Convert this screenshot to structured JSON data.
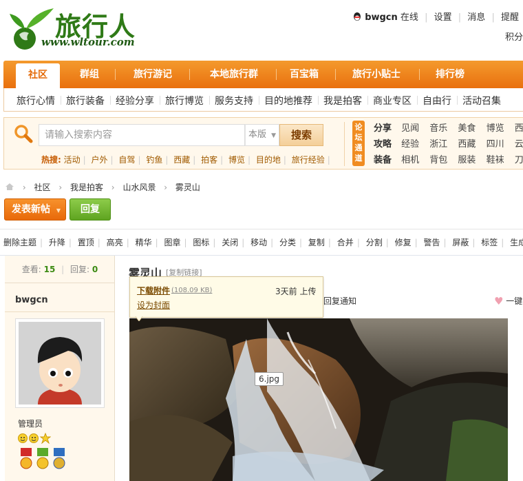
{
  "header": {
    "logo_text": "旅行人",
    "logo_url": "www.wltour.com",
    "user": {
      "name": "bwgcn",
      "status": "在线"
    },
    "links": [
      "设置",
      "消息",
      "提醒"
    ],
    "credit_label": "积分"
  },
  "nav": {
    "items": [
      "社区",
      "群组",
      "旅行游记",
      "本地旅行群",
      "百宝箱",
      "旅行小贴士",
      "排行榜"
    ],
    "active": "社区"
  },
  "subnav": [
    "旅行心情",
    "旅行装备",
    "经验分享",
    "旅行博览",
    "服务支持",
    "目的地推荐",
    "我是拍客",
    "商业专区",
    "自由行",
    "活动召集"
  ],
  "search": {
    "placeholder": "请输入搜索内容",
    "scope": "本版",
    "button": "搜索",
    "hot_label": "热搜:",
    "hot": [
      "活动",
      "户外",
      "自驾",
      "钓鱼",
      "西藏",
      "拍客",
      "博览",
      "目的地",
      "旅行经验"
    ]
  },
  "channels": {
    "badge": "论坛通道",
    "rows": [
      {
        "lead": "分享",
        "items": [
          "见闻",
          "音乐",
          "美食",
          "博览",
          "西藏"
        ]
      },
      {
        "lead": "攻略",
        "items": [
          "经验",
          "浙江",
          "西藏",
          "四川",
          "云南"
        ]
      },
      {
        "lead": "装备",
        "items": [
          "相机",
          "背包",
          "服装",
          "鞋袜",
          "刀具"
        ]
      }
    ]
  },
  "breadcrumb": [
    "社区",
    "我是拍客",
    "山水风景",
    "雾灵山"
  ],
  "actions": {
    "new_post": "发表新帖",
    "reply": "回复"
  },
  "moderation": [
    "删除主题",
    "升降",
    "置顶",
    "高亮",
    "精华",
    "图章",
    "图标",
    "关闭",
    "移动",
    "分类",
    "复制",
    "合并",
    "分割",
    "修复",
    "警告",
    "屏蔽",
    "标签",
    "生成文章"
  ],
  "thread": {
    "views_label": "查看:",
    "views": "15",
    "replies_label": "回复:",
    "replies": "0",
    "title": "雾灵山",
    "copy_link": "[复制链接]",
    "reply_notice": "回复通知",
    "fav": "一键"
  },
  "author": {
    "name": "bwgcn",
    "role": "管理员"
  },
  "attachment": {
    "download": "下载附件",
    "size": "(108.09 KB)",
    "uploaded": "3天前 上传",
    "set_cover": "设为封面",
    "filename": "6.jpg"
  },
  "colors": {
    "accent_orange": "#e9700e",
    "brand_green": "#2f7a17",
    "reply_green": "#5fa420"
  }
}
